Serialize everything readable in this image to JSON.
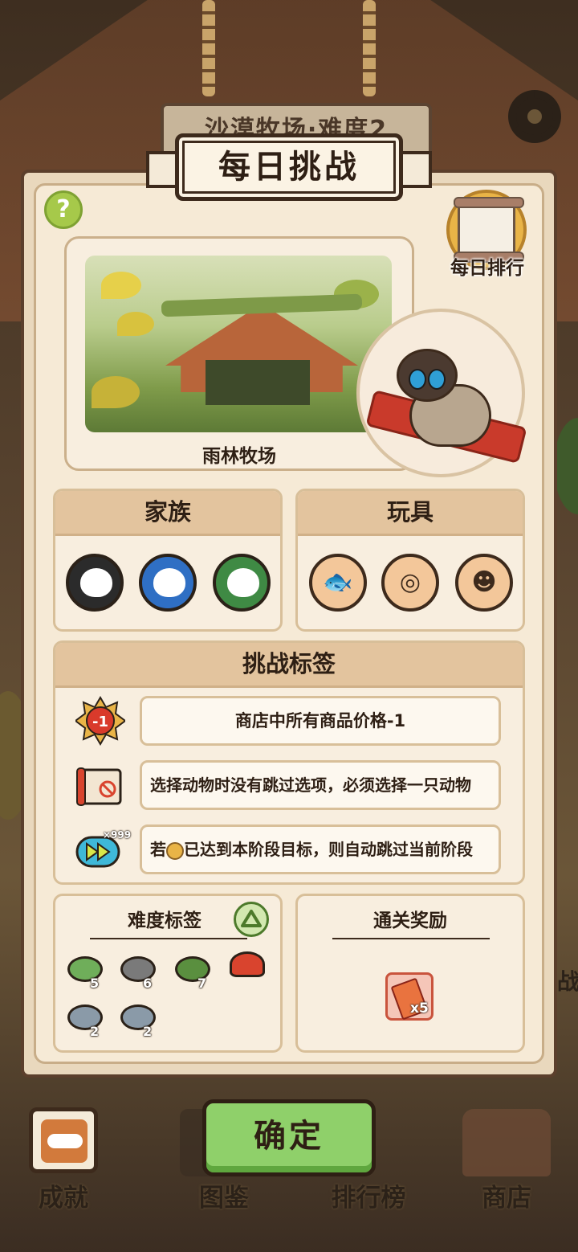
{
  "background": {
    "sign_text": "沙漠牧场·难度2",
    "side_text": "战"
  },
  "title": "每日挑战",
  "help_label": "?",
  "daily_ranking_label": "每日排行",
  "stage": {
    "name": "雨林牧场"
  },
  "families": {
    "header": "家族",
    "items": [
      {
        "icon": "dark-ghost-family-icon",
        "color": "#2b2b2b"
      },
      {
        "icon": "blue-bird-family-icon",
        "color": "#2f6fc4"
      },
      {
        "icon": "green-frog-family-icon",
        "color": "#3f8a44"
      }
    ]
  },
  "toys": {
    "header": "玩具",
    "items": [
      {
        "icon": "goldfish-toy-icon",
        "glyph": "🐟"
      },
      {
        "icon": "collar-toy-icon",
        "glyph": "◎"
      },
      {
        "icon": "daruma-toy-icon",
        "glyph": "☻"
      }
    ]
  },
  "challenge_tags": {
    "header": "挑战标签",
    "rows": [
      {
        "icon": "price-minus-one-icon",
        "text": "商店中所有商品价格-1"
      },
      {
        "icon": "no-skip-scroll-icon",
        "text": "选择动物时没有跳过选项，必须选择一只动物"
      },
      {
        "icon": "fast-forward-icon",
        "text_prefix": "若",
        "text_suffix": "已达到本阶段目标，则自动跳过当前阶段",
        "badge": "×999"
      }
    ]
  },
  "difficulty": {
    "title": "难度标签",
    "items": [
      {
        "icon": "frog-icon",
        "count": "5",
        "color": "#6fae5a"
      },
      {
        "icon": "dog-icon",
        "count": "6",
        "color": "#7a7a7a"
      },
      {
        "icon": "toad-icon",
        "count": "7",
        "color": "#5a8f3f"
      },
      {
        "icon": "fire-flower-icon",
        "count": "",
        "color": "#d9442e"
      },
      {
        "icon": "storm-cloud-icon",
        "count": "2",
        "color": "#8a9aa8"
      },
      {
        "icon": "timed-storm-cloud-icon",
        "count": "2",
        "color": "#8a9aa8"
      }
    ]
  },
  "reward": {
    "title": "通关奖励",
    "item": {
      "icon": "ticket-icon",
      "count": "x5"
    }
  },
  "nav": {
    "achievements": "成就",
    "encyclopedia": "图鉴",
    "leaderboard": "排行榜",
    "shop": "商店"
  },
  "confirm_label": "确定"
}
